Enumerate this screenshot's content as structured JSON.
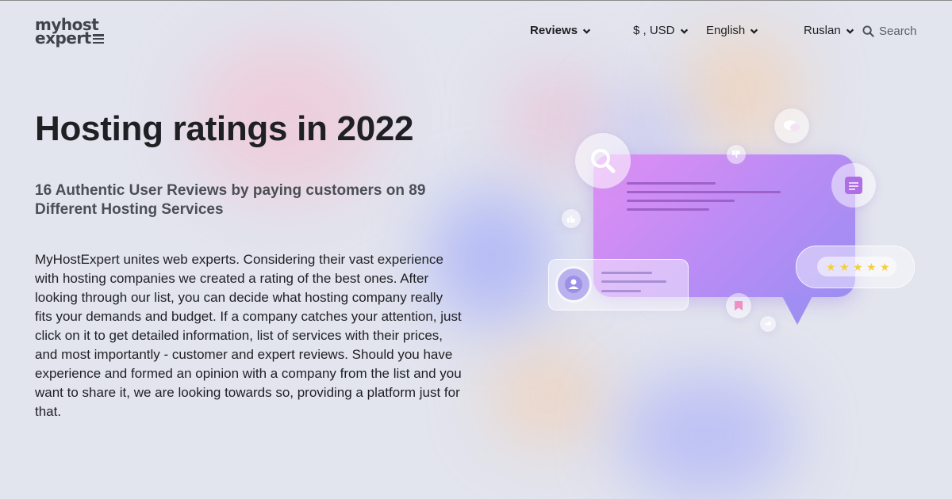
{
  "brand": {
    "logo_line1": "myhost",
    "logo_line2": "expert"
  },
  "nav": {
    "reviews": "Reviews",
    "currency": "$ , USD",
    "language": "English",
    "user": "Ruslan",
    "search": "Search"
  },
  "hero": {
    "title": "Hosting ratings in 2022",
    "subtitle": "16 Authentic User Reviews by paying customers on 89 Different Hosting Services",
    "description": "MyHostExpert unites web experts. Considering their vast experience with hosting companies we created a rating of the best ones. After looking through our list, you can decide what hosting company really fits your demands and budget. If a company catches your attention, just click on it to get detailed information, list of services with their prices, and most importantly - customer and expert reviews. Should you have experience and formed an opinion with a company from the list and you want to share it, we are looking towards so, providing a platform just for that."
  },
  "illustration": {
    "rating_stars": 5,
    "icons": [
      "search-icon",
      "document-icon",
      "user-icon",
      "bookmark-icon",
      "chat-icon",
      "thumbs-up-icon",
      "thumbs-down-icon",
      "share-icon"
    ]
  },
  "colors": {
    "text": "#1f2024",
    "subtle": "#4b4e55",
    "bubble_start": "#e08ef3",
    "bubble_end": "#9b8ef2",
    "star": "#f1cf45"
  }
}
